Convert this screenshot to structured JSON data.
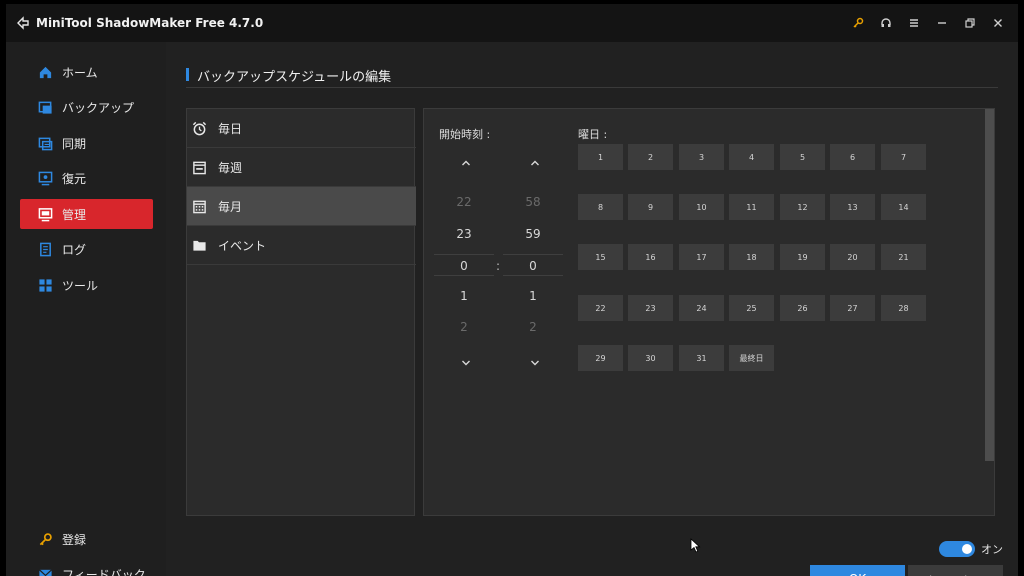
{
  "app": {
    "title": "MiniTool ShadowMaker Free 4.7.0",
    "accent_color": "#2e88e0",
    "active_color": "#d8262c"
  },
  "titlebar_icons": [
    "key-icon",
    "headset-icon",
    "menu-icon",
    "minimize-icon",
    "restore-icon",
    "close-icon"
  ],
  "sidebar": {
    "items": [
      {
        "label": "ホーム",
        "icon": "home-icon"
      },
      {
        "label": "バックアップ",
        "icon": "backup-icon"
      },
      {
        "label": "同期",
        "icon": "sync-icon"
      },
      {
        "label": "復元",
        "icon": "restore-icon"
      },
      {
        "label": "管理",
        "icon": "manage-icon",
        "active": true
      },
      {
        "label": "ログ",
        "icon": "log-icon"
      },
      {
        "label": "ツール",
        "icon": "tools-icon"
      }
    ],
    "bottom": [
      {
        "label": "登録",
        "icon": "key-icon"
      },
      {
        "label": "フィードバック",
        "icon": "mail-icon"
      }
    ]
  },
  "page": {
    "title": "バックアップスケジュールの編集"
  },
  "frequency": {
    "items": [
      {
        "label": "毎日",
        "icon": "alarm-clock-icon"
      },
      {
        "label": "毎週",
        "icon": "week-calendar-icon"
      },
      {
        "label": "毎月",
        "icon": "month-calendar-icon",
        "selected": true
      },
      {
        "label": "イベント",
        "icon": "folder-icon"
      }
    ]
  },
  "time": {
    "label": "開始時刻 :",
    "separator": ":",
    "hours": [
      "22",
      "23",
      "0",
      "1",
      "2"
    ],
    "minutes": [
      "58",
      "59",
      "0",
      "1",
      "2"
    ],
    "up_glyph": "^",
    "down_glyph": "v"
  },
  "days": {
    "label": "曜日 :",
    "items": [
      "1",
      "2",
      "3",
      "4",
      "5",
      "6",
      "7",
      "8",
      "9",
      "10",
      "11",
      "12",
      "13",
      "14",
      "15",
      "16",
      "17",
      "18",
      "19",
      "20",
      "21",
      "22",
      "23",
      "24",
      "25",
      "26",
      "27",
      "28",
      "29",
      "30",
      "31",
      "最終日"
    ]
  },
  "toggle": {
    "label": "オン",
    "on": true
  },
  "buttons": {
    "ok": "OK",
    "cancel": "キャンセル"
  }
}
